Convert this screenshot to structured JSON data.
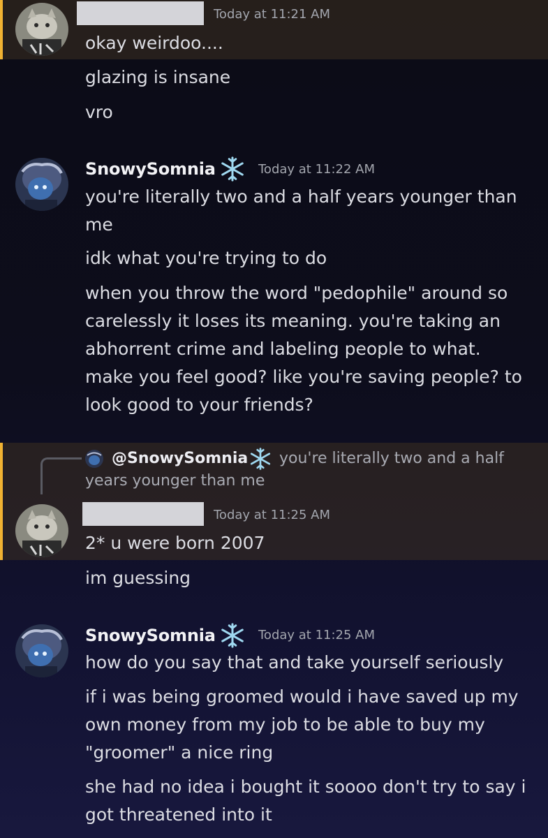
{
  "messages": {
    "group1": {
      "timestamp": "Today at 11:21 AM",
      "lines": [
        "okay weirdoo....",
        "glazing is insane",
        "vro"
      ]
    },
    "group2": {
      "username": "SnowySomnia",
      "timestamp": "Today at 11:22 AM",
      "lines": [
        "you're literally two and a half years younger than me",
        "idk what you're trying to do",
        "when you throw the word \"pedophile\" around so carelessly it loses its meaning. you're taking an abhorrent crime and labeling people  to what. make you feel good? like you're saving people? to look good to your friends?"
      ]
    },
    "reply": {
      "username": "@SnowySomnia",
      "text_line1": "you're literally two and a half",
      "text_line2": "years younger than me"
    },
    "group3": {
      "timestamp": "Today at 11:25 AM",
      "lines": [
        "2* u were born 2007",
        "im guessing"
      ]
    },
    "group4": {
      "username": "SnowySomnia",
      "timestamp": "Today at 11:25 AM",
      "lines": [
        "how do you say that and take yourself seriously",
        "if i was being groomed would i have saved up my own money from my job to be able to buy my \"groomer\" a nice ring",
        "she had no idea i bought it soooo don't try to say i got threatened into it"
      ]
    }
  },
  "icons": {
    "snowflake": "snowflake-icon",
    "avatar_other": "cat-avatar",
    "avatar_snowy": "character-avatar"
  },
  "colors": {
    "mention_highlight": "#f0b232",
    "username": "#f2f2f5",
    "timestamp": "#a3a6ae",
    "snowflake": "#9fd8f0"
  }
}
